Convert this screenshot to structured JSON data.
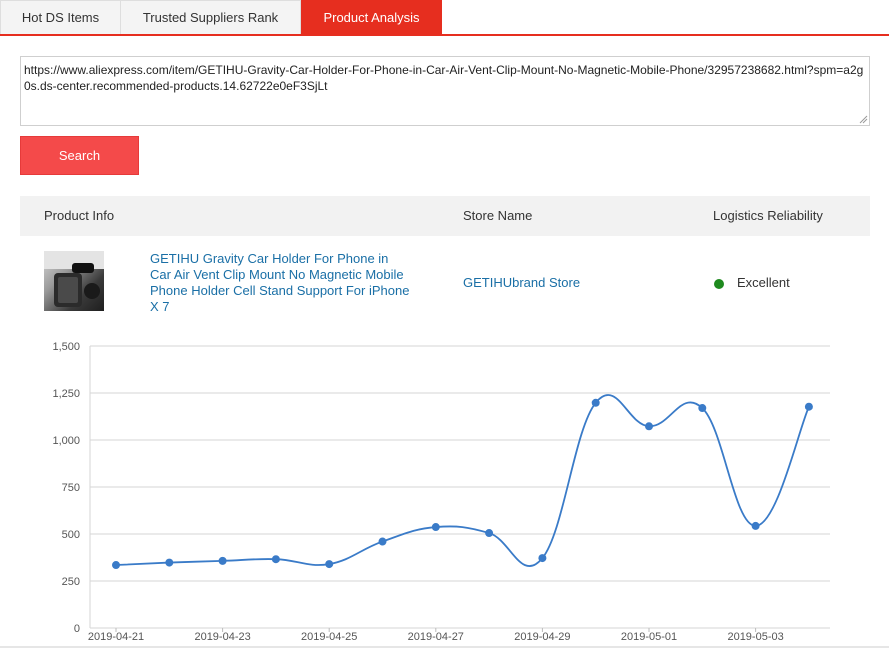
{
  "tabs": [
    {
      "label": "Hot DS Items",
      "active": false
    },
    {
      "label": "Trusted Suppliers Rank",
      "active": false
    },
    {
      "label": "Product Analysis",
      "active": true
    }
  ],
  "search": {
    "url_value": "https://www.aliexpress.com/item/GETIHU-Gravity-Car-Holder-For-Phone-in-Car-Air-Vent-Clip-Mount-No-Magnetic-Mobile-Phone/32957238682.html?spm=a2g0s.ds-center.recommended-products.14.62722e0eF3SjLt",
    "button_label": "Search"
  },
  "table": {
    "headers": {
      "product_info": "Product Info",
      "store_name": "Store Name",
      "logistics_reliability": "Logistics Reliability"
    },
    "row": {
      "product_title": "GETIHU Gravity Car Holder For Phone in Car Air Vent Clip Mount No Magnetic Mobile Phone Holder Cell Stand Support For iPhone X 7",
      "store_name": "GETIHUbrand Store",
      "logistics_status": "Excellent",
      "logistics_status_color": "#1e8a1e"
    }
  },
  "colors": {
    "accent": "#e62e1f",
    "search_button": "#f44a4a",
    "link": "#1a6fa6",
    "series": "#3a7bc8"
  },
  "chart_data": {
    "type": "line",
    "x_tick_labels": [
      "2019-04-21",
      "2019-04-23",
      "2019-04-25",
      "2019-04-27",
      "2019-04-29",
      "2019-05-01",
      "2019-05-03"
    ],
    "y_tick_labels": [
      "0",
      "250",
      "500",
      "750",
      "1,000",
      "1,250",
      "1,500"
    ],
    "x": [
      "2019-04-21",
      "2019-04-22",
      "2019-04-23",
      "2019-04-24",
      "2019-04-25",
      "2019-04-26",
      "2019-04-27",
      "2019-04-28",
      "2019-04-29",
      "2019-04-30",
      "2019-05-01",
      "2019-05-02",
      "2019-05-03",
      "2019-05-04"
    ],
    "values": [
      335,
      348,
      357,
      366,
      340,
      460,
      537,
      505,
      372,
      1198,
      1073,
      1170,
      543,
      1177
    ],
    "ylim": [
      0,
      1500
    ],
    "grid": true,
    "smooth": true
  }
}
